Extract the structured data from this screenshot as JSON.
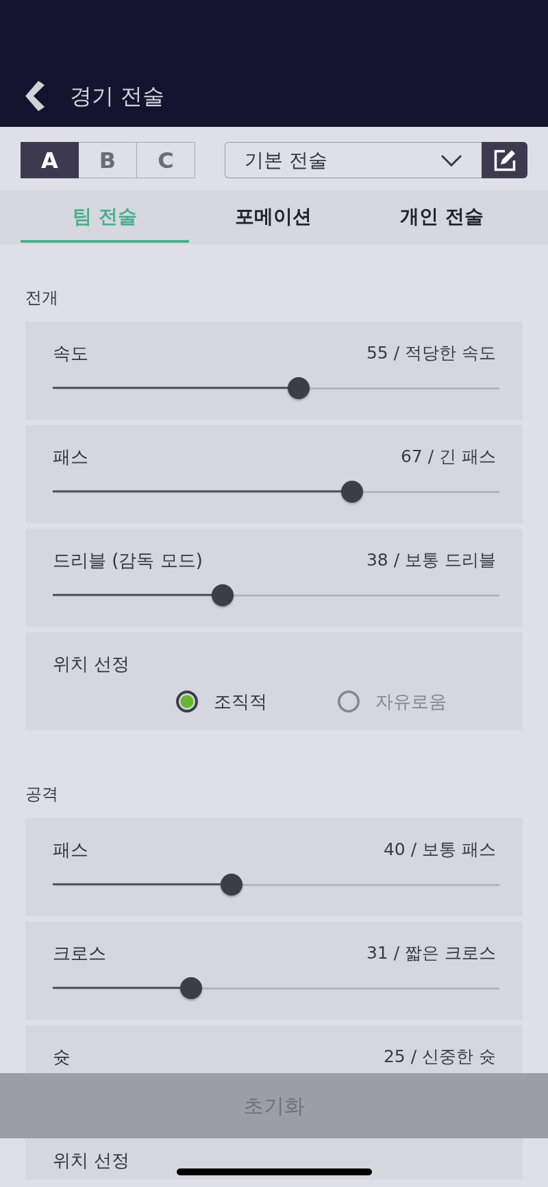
{
  "header": {
    "title": "경기 전술"
  },
  "presets": [
    {
      "label": "A",
      "selected": true
    },
    {
      "label": "B",
      "selected": false
    },
    {
      "label": "C",
      "selected": false
    }
  ],
  "tactic_select": {
    "value": "기본 전술"
  },
  "tabs": [
    {
      "label": "팀 전술",
      "selected": true
    },
    {
      "label": "포메이션",
      "selected": false
    },
    {
      "label": "개인 전술",
      "selected": false
    }
  ],
  "sections": [
    {
      "title": "전개",
      "settings": [
        {
          "kind": "slider",
          "label": "속도",
          "reading": "55 / 적당한 속도",
          "level": 0.55
        },
        {
          "kind": "slider",
          "label": "패스",
          "reading": "67 / 긴 패스",
          "level": 0.67
        },
        {
          "kind": "slider",
          "label": "드리블 (감독 모드)",
          "reading": "38 / 보통 드리블",
          "level": 0.38
        },
        {
          "kind": "radio",
          "label": "위치 선정",
          "options": [
            {
              "label": "조직적",
              "selected": true
            },
            {
              "label": "자유로움",
              "selected": false
            }
          ]
        }
      ]
    },
    {
      "title": "공격",
      "settings": [
        {
          "kind": "slider",
          "label": "패스",
          "reading": "40 / 보통 패스",
          "level": 0.4
        },
        {
          "kind": "slider",
          "label": "크로스",
          "reading": "31 / 짧은 크로스",
          "level": 0.31
        },
        {
          "kind": "slider",
          "label": "슛",
          "reading": "25 / 신중한 슛"
        },
        {
          "kind": "radio",
          "label": "위치 선정"
        }
      ]
    }
  ],
  "reset_button": {
    "label": "초기화",
    "disabled": true
  }
}
